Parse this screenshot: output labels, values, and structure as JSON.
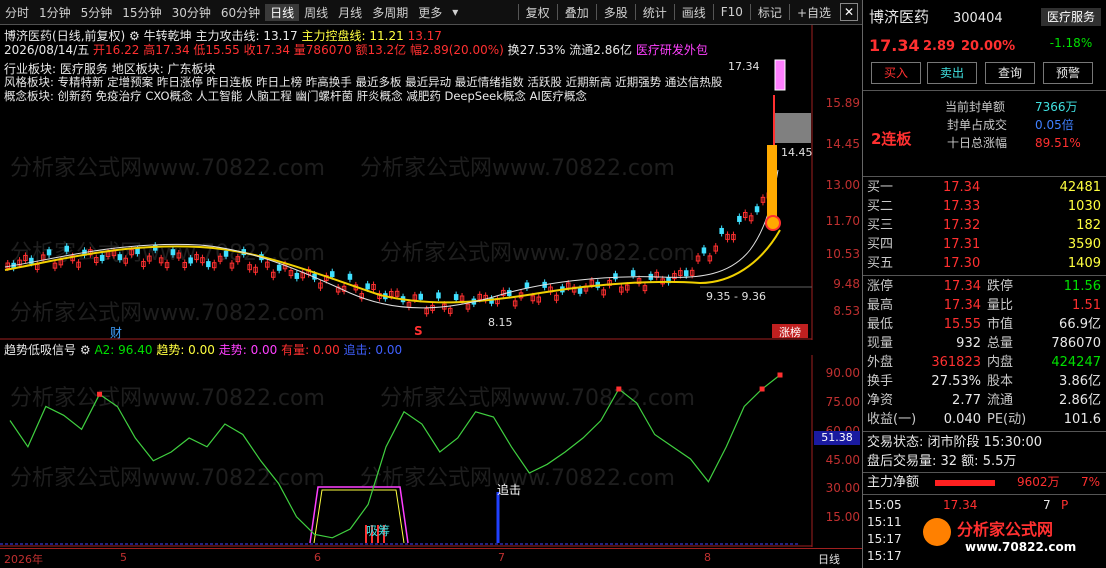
{
  "toolbar": {
    "items": [
      "分时",
      "1分钟",
      "5分钟",
      "15分钟",
      "30分钟",
      "60分钟",
      "日线",
      "周线",
      "月线",
      "多周期",
      "更多"
    ],
    "active": "日线",
    "right": [
      "复权",
      "叠加",
      "多股",
      "统计",
      "画线",
      "F10",
      "标记",
      "+自选"
    ],
    "close": "✕"
  },
  "stock": {
    "name": "博济医药",
    "code": "300404",
    "period_label": "(日线,前复权)",
    "indicator": "牛转乾坤",
    "line1_label": "主力攻击线: 13.17",
    "line2_label": "主力控盘线: 11.21",
    "line3_label": "13.17",
    "date": "2026/08/14/五",
    "open": "开16.22",
    "high": "高17.34",
    "low": "低15.55",
    "close": "收17.34",
    "vol": "量786070",
    "amt": "额13.2亿",
    "chg": "幅2.89(20.00%)",
    "turnover": "换27.53%",
    "float": "流通2.86亿",
    "concept_tag": "医疗研发外包",
    "industry": "行业板块: 医疗服务",
    "region": "地区板块: 广东板块",
    "style": "风格板块: 专精特新 定增预案 昨日涨停 昨日连板 昨日上榜 昨高换手 最近多板 最近异动 最近情绪指数 活跃股 近期新高 近期强势 通达信热股",
    "concepts": "概念板块: 创新药 免疫治疗 CXO概念 人工智能 人脑工程 幽门螺杆菌 肝炎概念 减肥药 DeepSeek概念 AI医疗概念",
    "marker_cai": "财",
    "marker_s": "S",
    "marker_zb": "涨榜"
  },
  "main_chart": {
    "y_labels": [
      "15.89",
      "14.45",
      "13.00",
      "11.70",
      "10.53",
      "9.48",
      "8.53"
    ],
    "top_price": "17.34",
    "label_1445": "14.45",
    "low_label": "8.15",
    "range_label": "9.35 - 9.36"
  },
  "sub_chart": {
    "title": "趋势低吸信号",
    "a2": "A2: 96.40",
    "qs": "趋势: 0.00",
    "zs": "走势: 0.00",
    "yl": "有量: 0.00",
    "zj": "追击: 0.00",
    "y_labels": [
      "90.00",
      "75.00",
      "60.00",
      "45.00",
      "30.00",
      "15.00"
    ],
    "cur_label": "51.38",
    "zhuiji": "追击",
    "xitu": "吸筹",
    "x_labels": [
      "2026年",
      "5",
      "6",
      "7",
      "8"
    ],
    "period": "日线"
  },
  "chart_data": {
    "type": "line",
    "title": "趋势低吸信号",
    "series": [
      {
        "name": "A2",
        "values": [
          70,
          55,
          78,
          73,
          65,
          85,
          78,
          60,
          47,
          52,
          60,
          55,
          68,
          62,
          47,
          34,
          15,
          5,
          3,
          8,
          22,
          55,
          75,
          68,
          52,
          60,
          75,
          72,
          55,
          40,
          45,
          52,
          60,
          70,
          88,
          80,
          62,
          55,
          48,
          35,
          55,
          78,
          88,
          96
        ]
      }
    ],
    "ylim": [
      0,
      100
    ]
  },
  "rp": {
    "name": "博济医药",
    "code": "300404",
    "tag": "医疗服务",
    "tag_pct": "-1.18%",
    "price": "17.34",
    "chg": "2.89",
    "pct": "20.00%",
    "buy": "买入",
    "sell": "卖出",
    "query": "查询",
    "warn": "预警",
    "lianban": "2连板",
    "fd_lab": "当前封单额",
    "fd_val": "7366万",
    "cj_lab": "封单占成交",
    "cj_val": "0.05倍",
    "zf_lab": "十日总涨幅",
    "zf_val": "89.51%",
    "bids": [
      {
        "l": "买一",
        "p": "17.34",
        "v": "42481"
      },
      {
        "l": "买二",
        "p": "17.33",
        "v": "1030"
      },
      {
        "l": "买三",
        "p": "17.32",
        "v": "182"
      },
      {
        "l": "买四",
        "p": "17.31",
        "v": "3590"
      },
      {
        "l": "买五",
        "p": "17.30",
        "v": "1409"
      }
    ],
    "stats": [
      [
        "涨停",
        "17.34",
        "跌停",
        "11.56"
      ],
      [
        "最高",
        "17.34",
        "量比",
        "1.51"
      ],
      [
        "最低",
        "15.55",
        "市值",
        "66.9亿"
      ],
      [
        "现量",
        "932",
        "总量",
        "786070"
      ],
      [
        "外盘",
        "361823",
        "内盘",
        "424247"
      ],
      [
        "换手",
        "27.53%",
        "股本",
        "3.86亿"
      ],
      [
        "净资",
        "2.77",
        "流通",
        "2.86亿"
      ],
      [
        "收益(一)",
        "0.040",
        "PE(动)",
        "101.6"
      ]
    ],
    "state": "交易状态: 闭市阶段 15:30:00",
    "after": "盘后交易量: 32 额: 5.5万",
    "zljl": "主力净额",
    "zljl_val": "9602万",
    "zljl_pct": "7%",
    "ticks": [
      [
        "15:05",
        "17.34",
        "7",
        "P"
      ],
      [
        "15:11",
        "",
        ""
      ],
      [
        "15:17",
        "",
        ""
      ],
      [
        "15:17",
        "",
        ""
      ]
    ],
    "logo": "分析家公式网",
    "logo_url": "www.70822.com"
  }
}
